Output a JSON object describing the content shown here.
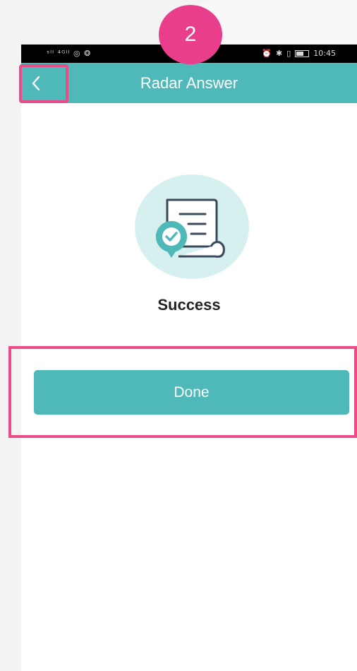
{
  "status_bar": {
    "left_icons": "ˢᴵᴵ ⁴ᴳᴵᴵ ◎ ❂",
    "time": "10:45"
  },
  "nav": {
    "title": "Radar Answer",
    "back_icon": "chevron-left-icon"
  },
  "content": {
    "status_title": "Success",
    "document_icon": "document-check-icon"
  },
  "actions": {
    "done_label": "Done"
  },
  "annotation": {
    "step_number": "2"
  },
  "colors": {
    "accent": "#4fb8b8",
    "highlight": "#ec4b8a",
    "badge": "#e83e8c",
    "icon_bg": "#d6f0f0"
  }
}
